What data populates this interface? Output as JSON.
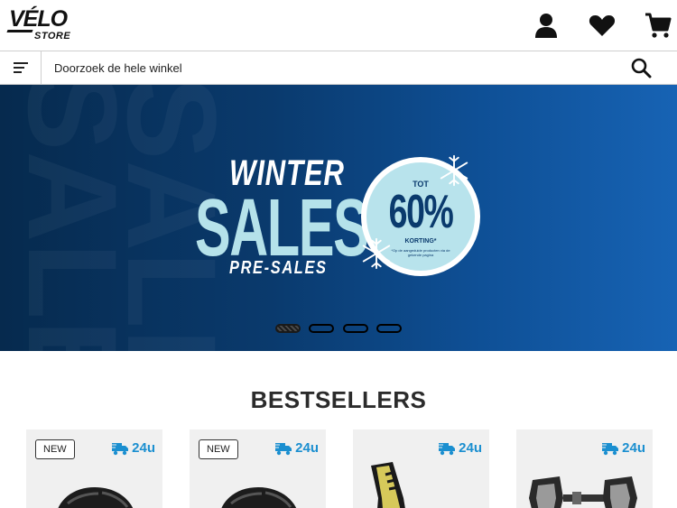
{
  "header": {
    "logo_top": "VÉLO",
    "logo_bottom": "STORE",
    "icons": [
      "account-icon",
      "wishlist-heart-icon",
      "cart-icon"
    ]
  },
  "search": {
    "placeholder": "Doorzoek de hele winkel",
    "value": ""
  },
  "hero": {
    "line1": "WINTER",
    "line2": "SALES",
    "line3": "PRE-SALES",
    "badge_top": "TOT",
    "badge_value": "60%",
    "badge_bottom": "KORTING*",
    "badge_fine": "*Op de aangeduide producten via de gekende pagina",
    "slides": 4,
    "active_slide": 1
  },
  "bestsellers": {
    "title": "BESTSELLERS",
    "products": [
      {
        "tag": "NEW",
        "delivery": "24u",
        "image": "helmet"
      },
      {
        "tag": "NEW",
        "delivery": "24u",
        "image": "helmet"
      },
      {
        "tag": "",
        "delivery": "24u",
        "image": "winter-shoe"
      },
      {
        "tag": "",
        "delivery": "24u",
        "image": "pedals"
      }
    ]
  },
  "colors": {
    "accent": "#1b8fd0",
    "hero_dark": "#062a4e",
    "hero_light": "#b5e2ea",
    "text": "#222222"
  }
}
